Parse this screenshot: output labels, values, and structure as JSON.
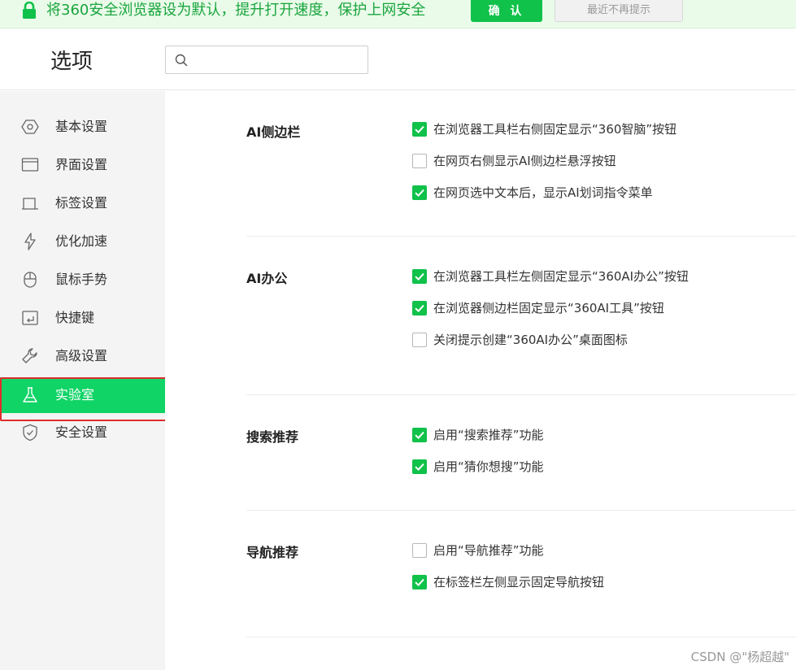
{
  "notification": {
    "text": "将360安全浏览器设为默认，提升打开速度，保护上网安全",
    "confirm_label": "确 认",
    "dismiss_label": "最近不再提示"
  },
  "header": {
    "title": "选项",
    "search_placeholder": "",
    "search_value": ""
  },
  "sidebar": {
    "items": [
      {
        "label": "基本设置",
        "icon": "hexagon-settings-icon"
      },
      {
        "label": "界面设置",
        "icon": "window-icon"
      },
      {
        "label": "标签设置",
        "icon": "tab-icon"
      },
      {
        "label": "优化加速",
        "icon": "lightning-icon"
      },
      {
        "label": "鼠标手势",
        "icon": "mouse-icon"
      },
      {
        "label": "快捷键",
        "icon": "keyboard-shortcut-icon"
      },
      {
        "label": "高级设置",
        "icon": "wrench-icon"
      },
      {
        "label": "实验室",
        "icon": "flask-icon",
        "active": true
      },
      {
        "label": "安全设置",
        "icon": "shield-icon"
      }
    ]
  },
  "sections": [
    {
      "title": "AI侧边栏",
      "options": [
        {
          "label": "在浏览器工具栏右侧固定显示“360智脑”按钮",
          "checked": true
        },
        {
          "label": "在网页右侧显示AI侧边栏悬浮按钮",
          "checked": false
        },
        {
          "label": "在网页选中文本后，显示AI划词指令菜单",
          "checked": true
        }
      ]
    },
    {
      "title": "AI办公",
      "options": [
        {
          "label": "在浏览器工具栏左侧固定显示“360AI办公”按钮",
          "checked": true
        },
        {
          "label": "在浏览器侧边栏固定显示“360AI工具”按钮",
          "checked": true
        },
        {
          "label": "关闭提示创建“360AI办公”桌面图标",
          "checked": false
        }
      ]
    },
    {
      "title": "搜索推荐",
      "options": [
        {
          "label": "启用“搜索推荐”功能",
          "checked": true
        },
        {
          "label": "启用“猜你想搜”功能",
          "checked": true
        }
      ]
    },
    {
      "title": "导航推荐",
      "options": [
        {
          "label": "启用“导航推荐”功能",
          "checked": false
        },
        {
          "label": "在标签栏左侧显示固定导航按钮",
          "checked": true
        }
      ]
    }
  ],
  "watermark": "CSDN @\"杨超越\"",
  "colors": {
    "accent": "#10c14a",
    "sidebar_active": "#10d466",
    "notify_bg": "#eafbe9",
    "notify_text": "#1aa53e",
    "annotation": "#e02c2c"
  }
}
